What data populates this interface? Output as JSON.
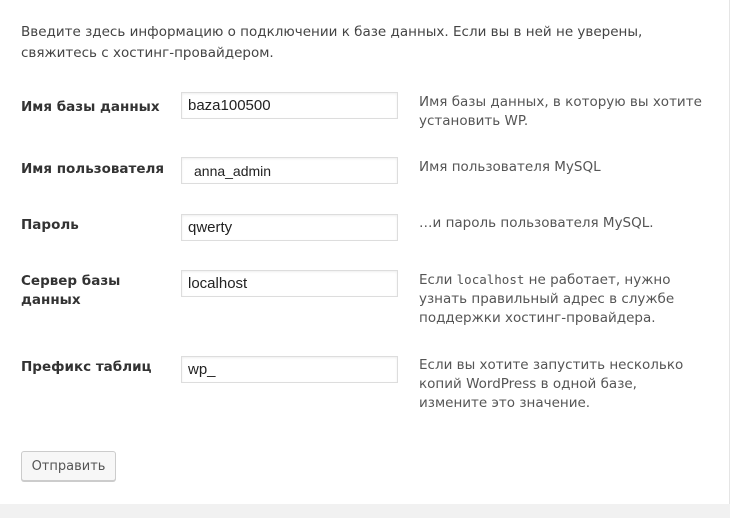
{
  "intro": "Введите здесь информацию о подключении к базе данных. Если вы в ней не уверены, свяжитесь с хостинг-провайдером.",
  "fields": [
    {
      "label": "Имя базы данных",
      "value": "baza100500",
      "help": "Имя базы данных, в которую вы хотите установить WP."
    },
    {
      "label": "Имя пользователя",
      "value": "anna_admin",
      "help": "Имя пользователя MySQL"
    },
    {
      "label": "Пароль",
      "value": "qwerty",
      "help": "…и пароль пользователя MySQL."
    },
    {
      "label": "Сервер базы данных",
      "value": "localhost",
      "help_prefix": "Если ",
      "help_code": "localhost",
      "help_suffix": " не работает, нужно узнать правильный адрес в службе поддержки хостинг-провайдера."
    },
    {
      "label": "Префикс таблиц",
      "value": "wp_",
      "help": "Если вы хотите запустить несколько копий WordPress в одной базе, измените это значение."
    }
  ],
  "submit_label": "Отправить"
}
